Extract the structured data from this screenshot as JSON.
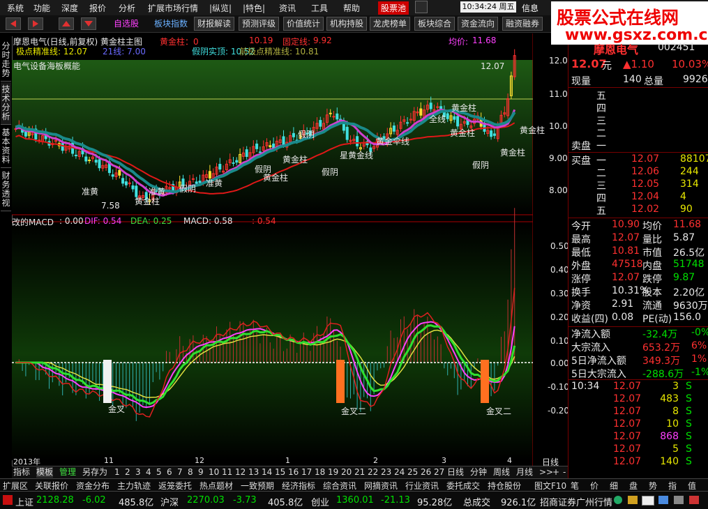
{
  "menu": {
    "items": [
      "系统",
      "功能",
      "深度",
      "报价",
      "分析",
      "扩展市场行情",
      "|纵览|",
      "|特色|",
      "资讯",
      "工具",
      "帮助"
    ],
    "stock_pool": "股票池",
    "time": "10:34:24",
    "weekday": "周五",
    "info": "信息"
  },
  "toolbar": {
    "buttons": [
      "自选股",
      "板块指数",
      "财报解读",
      "预测评级",
      "价值统计",
      "机构持股",
      "龙虎榜单",
      "板块综合",
      "资金流向",
      "融资融券"
    ]
  },
  "watermark": {
    "line1": "股票公式在线网",
    "line2": "www.gsxz.com.cn"
  },
  "left_tabs": [
    "分时走势",
    "技术分析",
    "基本资料",
    "财务透视"
  ],
  "chart_header": {
    "title": "摩恩电气(日线,前复权) 黄金柱主图",
    "gold_label": "黄金柱：0",
    "value1": "10.19",
    "fixed_label": "固定线:",
    "fixed_val": "9.92",
    "avg_label": "均价:",
    "avg_val": "11.68",
    "line2_a": "极点精准线: 12.07",
    "line2_b": "21线: 7.00",
    "line2_c": "假阴实顶: 10.52",
    "line2_d": "前极点精准线: 10.81",
    "sector": "电气设备海板概能"
  },
  "price_axis": [
    "12.00",
    "11.00",
    "10.00",
    "9.00",
    "8.00"
  ],
  "price_labels": {
    "top": "12.07",
    "low": "7.58"
  },
  "annotations": [
    "黄金柱",
    "黄金柱",
    "黄金柱",
    "黄金柱",
    "黄金柱",
    "黄金柱",
    "假阴",
    "假阴",
    "假阴",
    "假阴",
    "假阴",
    "准黄",
    "准黄",
    "准黄",
    "黄金伞线",
    "全线",
    "星黄金线",
    "黄金柱"
  ],
  "macd_header": {
    "name": "改的MACD",
    "v0": ": 0.00",
    "dif": "DIF: 0.54",
    "dea": "DEA: 0.25",
    "macd": "MACD: 0.58",
    "v5": ": 0.54"
  },
  "macd_axis": [
    "0.50",
    "0.40",
    "0.30",
    "0.20",
    "0.10",
    "0.00",
    "-0.10",
    "-0.20"
  ],
  "macd_labels": [
    "金叉",
    "金叉二",
    "金叉二"
  ],
  "date_axis": {
    "year": "2013年",
    "labels": [
      "11",
      "12",
      "1",
      "2",
      "3",
      "4"
    ]
  },
  "period": "日线",
  "bottom_tabs": [
    "指标",
    "模板",
    "管理",
    "另存为",
    "1",
    "2",
    "3",
    "4",
    "5",
    "6",
    "7",
    "8",
    "9",
    "10",
    "11",
    "12",
    "13",
    "14",
    "15",
    "16",
    "17",
    "18",
    "19",
    "20",
    "21",
    "22",
    "23",
    "24",
    "25",
    "26",
    "27",
    "日线",
    "分钟",
    "周线",
    "月线",
    ">>",
    "+",
    "-",
    "0"
  ],
  "func_tabs": [
    "扩展区",
    "关联报价",
    "资金分布",
    "主力轨迹",
    "返笼委托",
    "热点题材",
    "一致预期",
    "经济指标",
    "综合资讯",
    "网摘资讯",
    "行业资讯",
    "委托成交",
    "持仓股份",
    "图文F10"
  ],
  "func_right": [
    "笔",
    "价",
    "细",
    "盘",
    "势",
    "指",
    "值"
  ],
  "quote": {
    "name": "摩恩电气",
    "code": "002451",
    "price": "12.07",
    "unit": "元",
    "change": "▲1.10",
    "pct": "10.03%",
    "xianliang_label": "现量",
    "xianliang": "140",
    "zongliang_label": "总量",
    "zongliang": "99266",
    "sell_levels": [
      "五",
      "四",
      "三",
      "二",
      "一"
    ],
    "sell_label": "卖盘",
    "buy_label": "买盘",
    "buy": [
      {
        "lvl": "一",
        "price": "12.07",
        "vol": "88107"
      },
      {
        "lvl": "二",
        "price": "12.06",
        "vol": "244"
      },
      {
        "lvl": "三",
        "price": "12.05",
        "vol": "314"
      },
      {
        "lvl": "四",
        "price": "12.04",
        "vol": "4"
      },
      {
        "lvl": "五",
        "price": "12.02",
        "vol": "90"
      }
    ],
    "stats": [
      {
        "l1": "今开",
        "v1": "10.90",
        "l2": "均价",
        "v2": "11.68"
      },
      {
        "l1": "最高",
        "v1": "12.07",
        "l2": "量比",
        "v2": "5.87"
      },
      {
        "l1": "最低",
        "v1": "10.81",
        "l2": "市值",
        "v2": "26.5亿"
      },
      {
        "l1": "外盘",
        "v1": "47518",
        "l2": "内盘",
        "v2": "51748"
      },
      {
        "l1": "涨停",
        "v1": "12.07",
        "l2": "跌停",
        "v2": "9.87"
      },
      {
        "l1": "换手",
        "v1": "10.31%",
        "l2": "股本",
        "v2": "2.20亿"
      },
      {
        "l1": "净资",
        "v1": "2.91",
        "l2": "流通",
        "v2": "9630万"
      },
      {
        "l1": "收益(四)",
        "v1": "0.08",
        "l2": "PE(动)",
        "v2": "156.0"
      }
    ],
    "flows": [
      {
        "l": "净流入额",
        "v": "-32.4万",
        "p": "-0%"
      },
      {
        "l": "大宗流入",
        "v": "653.2万",
        "p": "6%"
      },
      {
        "l": "5日净流入额",
        "v": "349.3万",
        "p": "1%"
      },
      {
        "l": "5日大宗流入",
        "v": "-288.6万",
        "p": "-1%"
      }
    ],
    "ticks": [
      {
        "t": "10:34",
        "p": "12.07",
        "v": "3",
        "s": "S"
      },
      {
        "t": "",
        "p": "12.07",
        "v": "483",
        "s": "S"
      },
      {
        "t": "",
        "p": "12.07",
        "v": "8",
        "s": "S"
      },
      {
        "t": "",
        "p": "12.07",
        "v": "10",
        "s": "S"
      },
      {
        "t": "",
        "p": "12.07",
        "v": "868",
        "s": "S"
      },
      {
        "t": "",
        "p": "12.07",
        "v": "5",
        "s": "S"
      },
      {
        "t": "",
        "p": "12.07",
        "v": "140",
        "s": "S"
      }
    ]
  },
  "status": {
    "sh_label": "上证",
    "sh": "2128.28",
    "sh_chg": "-6.02",
    "sh_amt": "485.8亿",
    "hs_label": "沪深",
    "hs": "2270.03",
    "hs_chg": "-3.73",
    "hs_amt": "405.8亿",
    "cy_label": "创业",
    "cy": "1360.01",
    "cy_chg": "-21.13",
    "cy_amt": "95.28亿",
    "total_label": "总成交",
    "total": "926.1亿",
    "broker": "招商证券广州行情"
  }
}
